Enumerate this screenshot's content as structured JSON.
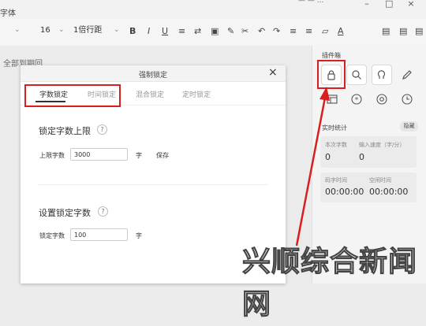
{
  "window": {
    "app_title": "字体",
    "top_right_text": "— — ..."
  },
  "toolbar": {
    "font_size": "16",
    "line_spacing": "1倍行距",
    "bold": "B",
    "italic": "I",
    "underline": "U",
    "font_color": "A"
  },
  "document": {
    "title_fragment": "全部到期回"
  },
  "dialog": {
    "title": "强制锁定",
    "close": "×",
    "tabs": [
      {
        "label": "字数锁定"
      },
      {
        "label": "时间锁定"
      },
      {
        "label": "混合锁定"
      },
      {
        "label": "定时锁定"
      }
    ],
    "active_tab": "字数锁定",
    "section1": {
      "title": "锁定字数上限",
      "help": "?",
      "field_label": "上限字数",
      "field_value": "3000",
      "unit": "字",
      "save": "保存"
    },
    "section2": {
      "title": "设置锁定字数",
      "help": "?",
      "field_label": "锁定字数",
      "field_value": "100",
      "unit": "字"
    }
  },
  "plugin_panel": {
    "title": "插件箱",
    "icons": [
      "lock-icon",
      "search-doc-icon",
      "head-icon",
      "pencil-icon",
      "table-icon",
      "asterisk-icon",
      "at-icon",
      "clock-icon"
    ]
  },
  "realtime_stats": {
    "title": "实时统计",
    "hide": "隐藏",
    "this_words_label": "本次字数",
    "this_words_value": "0",
    "speed_label": "输入速度（字/分）",
    "speed_value": "0",
    "typing_time_label": "码字时间",
    "typing_time_value": "00:00:00",
    "idle_time_label": "空闲时间",
    "idle_time_value": "00:00:00"
  },
  "watermark": "兴顺综合新闻网",
  "colors": {
    "highlight_red": "#d81e1e",
    "panel_bg": "#f4f4f4"
  }
}
